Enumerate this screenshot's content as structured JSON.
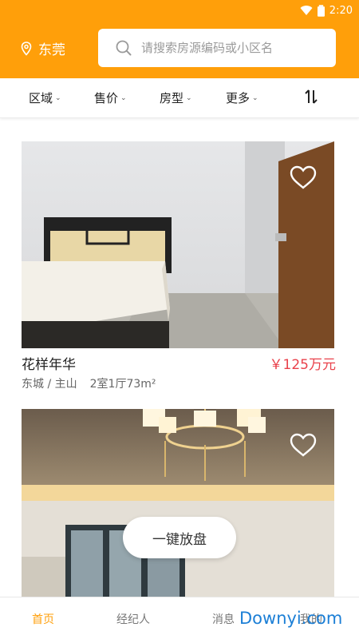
{
  "status_bar": {
    "time": "2:20",
    "icons": [
      "wifi-icon",
      "battery-icon"
    ]
  },
  "header": {
    "city": "东莞",
    "city_icon": "location-pin-icon",
    "search": {
      "placeholder": "请搜索房源编码或小区名",
      "value": "",
      "icon": "search-icon"
    }
  },
  "filters": [
    {
      "label": "区域"
    },
    {
      "label": "售价"
    },
    {
      "label": "房型"
    },
    {
      "label": "更多"
    }
  ],
  "sort_icon": "sort-arrows-icon",
  "listings": [
    {
      "title": "花样年华",
      "price": "￥125万元",
      "location": "东城 / 主山",
      "layout": "2室1厅73m²",
      "favorite_icon": "heart-outline-icon"
    },
    {
      "favorite_icon": "heart-outline-icon"
    }
  ],
  "publish_button": "一键放盘",
  "bottom_nav": [
    {
      "label": "首页",
      "active": true
    },
    {
      "label": "经纪人",
      "active": false
    },
    {
      "label": "消息",
      "active": false
    },
    {
      "label": "我的",
      "active": false
    }
  ],
  "watermark": "Downyi.com",
  "colors": {
    "brand": "#ff9f0a",
    "price": "#e9414b",
    "watermark": "#1c7fd6"
  }
}
